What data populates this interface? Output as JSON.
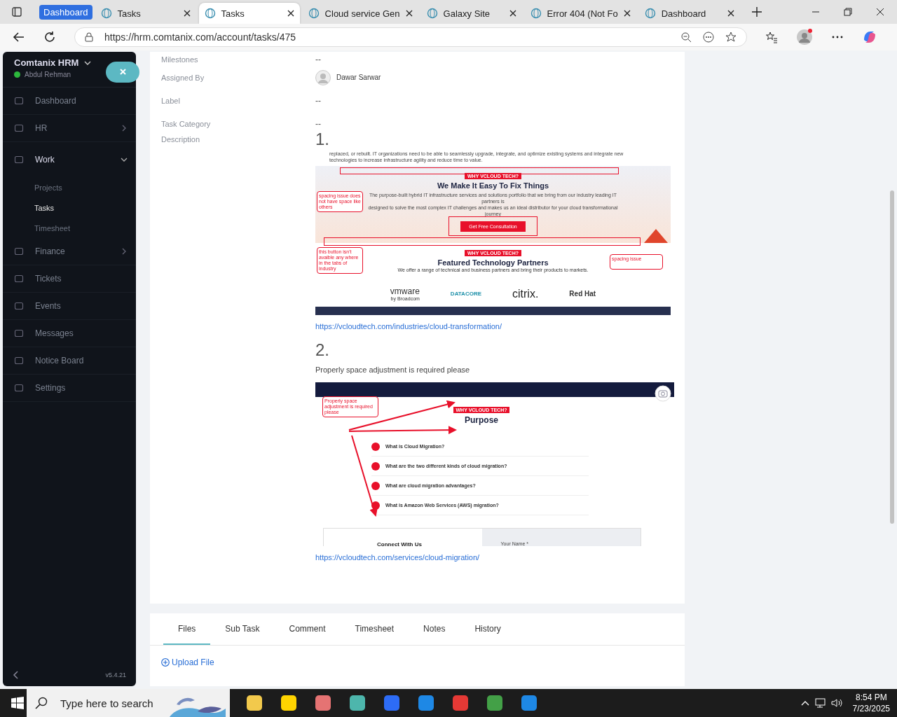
{
  "browser": {
    "tabs": [
      {
        "label": "Dashboard",
        "kind": "group",
        "selected": false
      },
      {
        "label": "Tasks",
        "kind": "page",
        "selected": false
      },
      {
        "label": "Tasks",
        "kind": "page",
        "selected": true
      },
      {
        "label": "Cloud service Gen",
        "kind": "page",
        "selected": false
      },
      {
        "label": "Galaxy Site",
        "kind": "page",
        "selected": false
      },
      {
        "label": "Error 404 (Not Fo",
        "kind": "page",
        "selected": false
      },
      {
        "label": "Dashboard",
        "kind": "page",
        "selected": false
      }
    ],
    "url": "https://hrm.comtanix.com/account/tasks/475"
  },
  "sidebar": {
    "brand": "Comtanix HRM",
    "user": "Abdul Rehman",
    "version": "v5.4.21",
    "items": [
      {
        "label": "Dashboard"
      },
      {
        "label": "HR",
        "expanded": false
      },
      {
        "label": "Work",
        "expanded": true,
        "children": [
          {
            "label": "Projects",
            "selected": false
          },
          {
            "label": "Tasks",
            "selected": true
          },
          {
            "label": "Timesheet",
            "selected": false
          }
        ]
      },
      {
        "label": "Finance",
        "expanded": false
      },
      {
        "label": "Tickets"
      },
      {
        "label": "Events"
      },
      {
        "label": "Messages"
      },
      {
        "label": "Notice Board"
      },
      {
        "label": "Settings"
      }
    ]
  },
  "task": {
    "fields": [
      {
        "label": "Milestones",
        "kind": "text",
        "value": "--"
      },
      {
        "label": "Assigned By",
        "kind": "person",
        "value": "Dawar Sarwar"
      },
      {
        "label": "Label",
        "kind": "text",
        "value": "--"
      },
      {
        "label": "Task Category",
        "kind": "text",
        "value": "--"
      }
    ],
    "description_label": "Description",
    "sections": [
      {
        "number": "1.",
        "kind": "partners",
        "link": "https://vcloudtech.com/industries/cloud-transformation/",
        "shot": {
          "paragraph": [
            "replaced, or rebuilt. IT organizations need to be able to seamlessly upgrade, integrate, and optimize existing systems and integrate new",
            "technologies to increase infrastructure agility and reduce time to value."
          ],
          "badge": "WHY VCLOUD TECH?",
          "heading": "We Make It Easy To Fix Things",
          "body": [
            "The purpose-built hybrid IT infrastructure services and solutions portfolio that we bring from our industry leading IT partners is",
            "designed to solve the most complex IT challenges and makes us an ideal distributor for your cloud transformational journey"
          ],
          "button": "Get Free Consultation",
          "badge2": "WHY VCLOUD TECH?",
          "heading2": "Featured Technology Partners",
          "sub": "We offer a range of technical and business partners and bring their products to markets.",
          "logos": [
            "vmware",
            "DATACORE",
            "citrix.",
            "Red Hat"
          ],
          "logo_note": "by Broadcom",
          "notes": [
            "spacing issue does not have space like others",
            "this button isn't avaible any where in the tabs of industry",
            "spacing issue"
          ]
        }
      },
      {
        "number": "2.",
        "kind": "purpose",
        "text": "Properly space adjustment is required please",
        "link": "https://vcloudtech.com/services/cloud-migration/",
        "shot": {
          "badge": "WHY VCLOUD TECH?",
          "heading": "Purpose",
          "questions": [
            "What is Cloud Migration?",
            "What are the two different kinds of cloud migration?",
            "What are cloud migration advantages?",
            "What is Amazon Web Services (AWS) migration?"
          ],
          "form_title": "Connect With Us",
          "form_field": "Your Name *",
          "notes": [
            "Properly space adjustment is required please"
          ]
        }
      }
    ]
  },
  "detail_tabs": [
    {
      "label": "Files",
      "selected": true
    },
    {
      "label": "Sub Task",
      "selected": false
    },
    {
      "label": "Comment",
      "selected": false
    },
    {
      "label": "Timesheet",
      "selected": false
    },
    {
      "label": "Notes",
      "selected": false
    },
    {
      "label": "History",
      "selected": false
    }
  ],
  "upload": "Upload File",
  "taskbar": {
    "search_placeholder": "Type here to search",
    "time": "8:54 PM",
    "date": "7/23/2025"
  }
}
